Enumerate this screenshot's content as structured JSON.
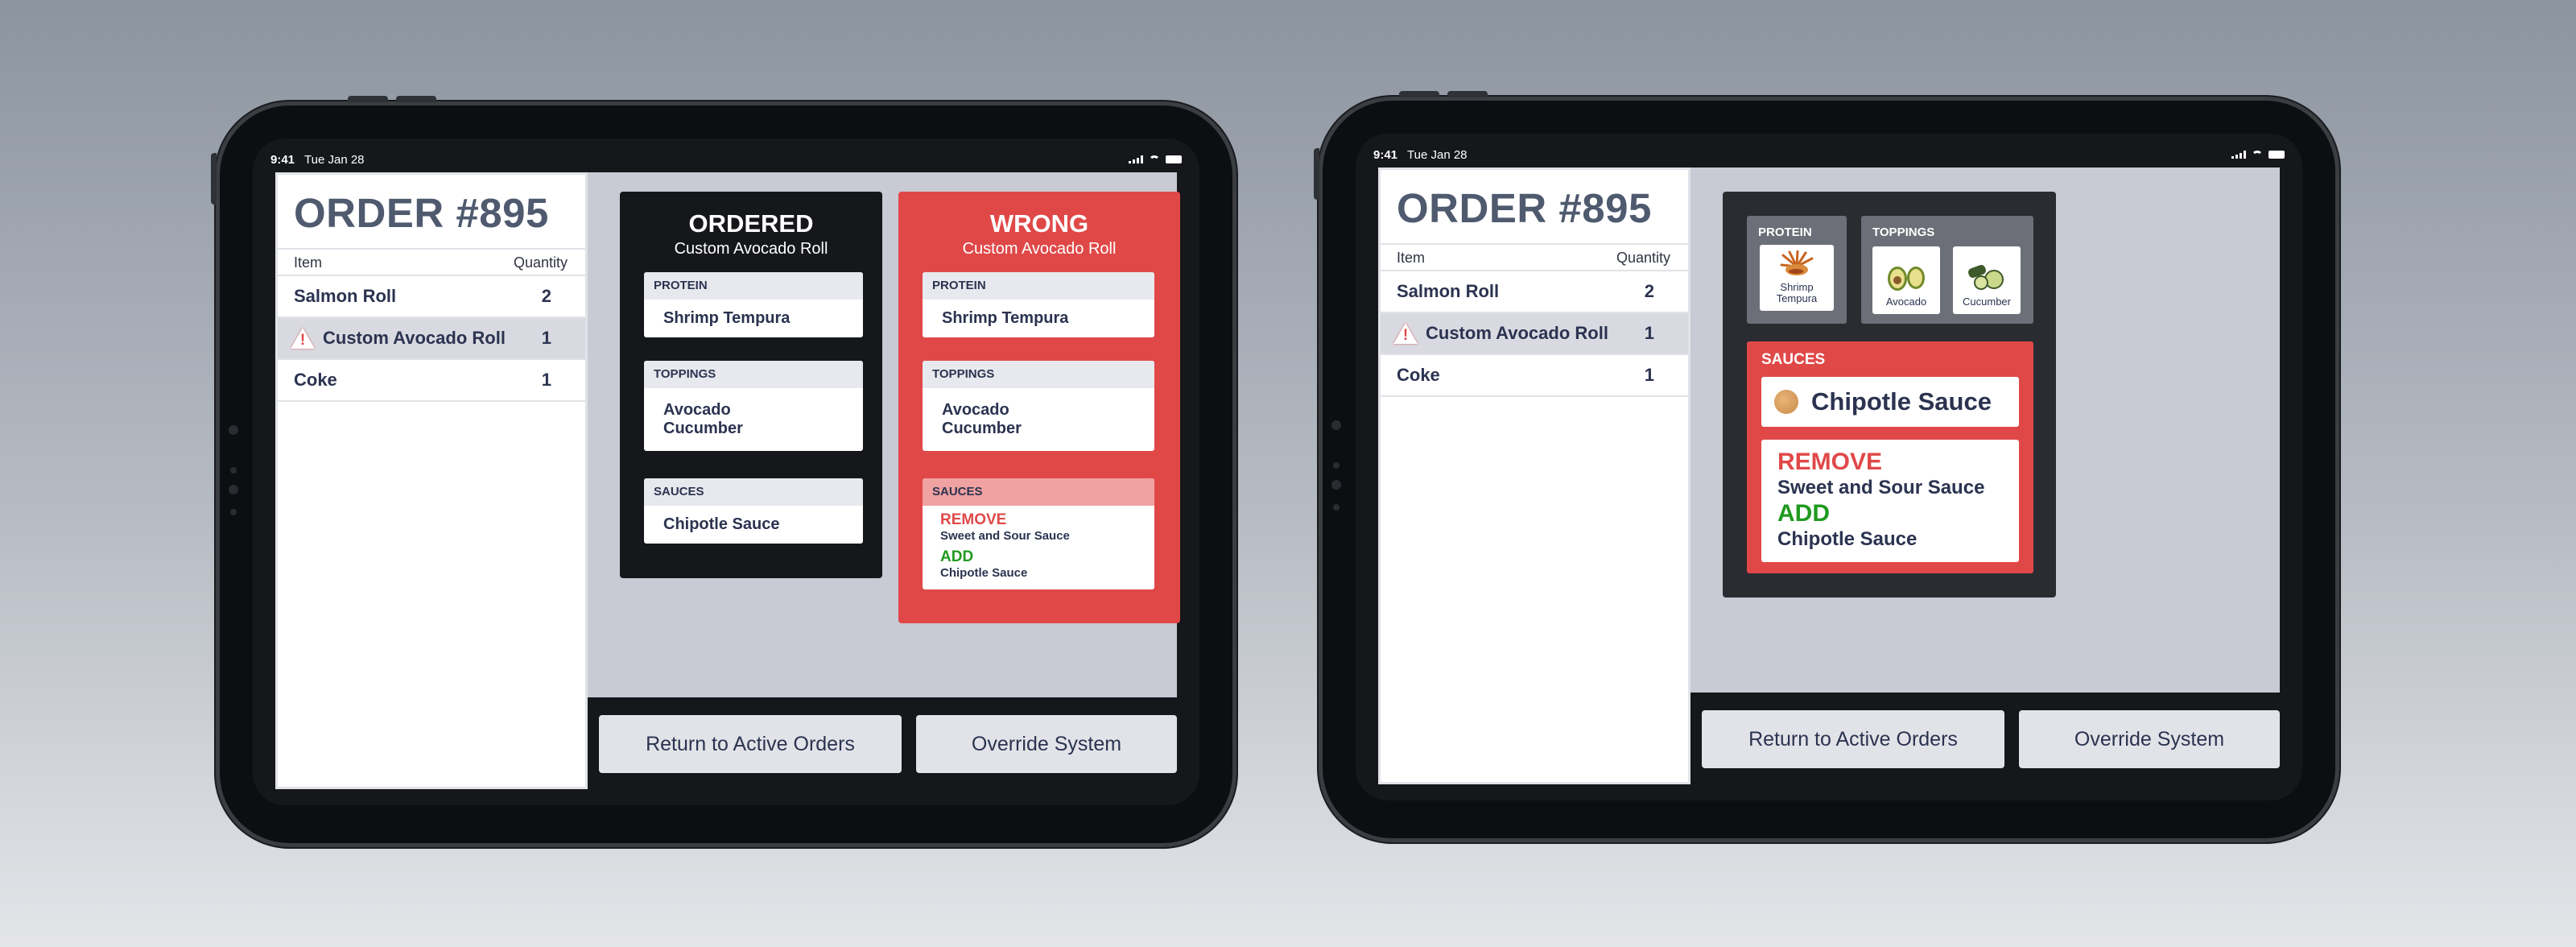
{
  "status": {
    "time": "9:41",
    "date": "Tue Jan 28"
  },
  "order": {
    "title": "ORDER #895",
    "col_item": "Item",
    "col_qty": "Quantity",
    "rows": [
      {
        "name": "Salmon Roll",
        "qty": "2"
      },
      {
        "name": "Custom Avocado Roll",
        "qty": "1"
      },
      {
        "name": "Coke",
        "qty": "1"
      }
    ]
  },
  "ordered_card": {
    "title": "ORDERED",
    "subtitle": "Custom Avocado Roll",
    "protein_label": "PROTEIN",
    "protein": "Shrimp Tempura",
    "toppings_label": "TOPPINGS",
    "toppings": [
      "Avocado",
      "Cucumber"
    ],
    "sauces_label": "SAUCES",
    "sauce": "Chipotle Sauce"
  },
  "wrong_card": {
    "title": "WRONG",
    "subtitle": "Custom Avocado Roll",
    "protein_label": "PROTEIN",
    "protein": "Shrimp Tempura",
    "toppings_label": "TOPPINGS",
    "toppings": [
      "Avocado",
      "Cucumber"
    ],
    "sauces_label": "SAUCES",
    "remove_label": "REMOVE",
    "remove_item": "Sweet and Sour Sauce",
    "add_label": "ADD",
    "add_item": "Chipotle Sauce"
  },
  "visual_card": {
    "protein_label": "PROTEIN",
    "protein_tile": "Shrimp Tempura",
    "toppings_label": "TOPPINGS",
    "topping_tiles": [
      "Avocado",
      "Cucumber"
    ],
    "sauces_label": "SAUCES",
    "current_sauce": "Chipotle Sauce",
    "remove_label": "REMOVE",
    "remove_item": "Sweet and Sour Sauce",
    "add_label": "ADD",
    "add_item": "Chipotle Sauce"
  },
  "actions": {
    "return_label": "Return to Active Orders",
    "override_label": "Override System"
  },
  "colors": {
    "alert_red": "#e04848",
    "dark_card": "#15171b",
    "add_green": "#1f9a1f",
    "app_bg": "#c9cad4"
  }
}
